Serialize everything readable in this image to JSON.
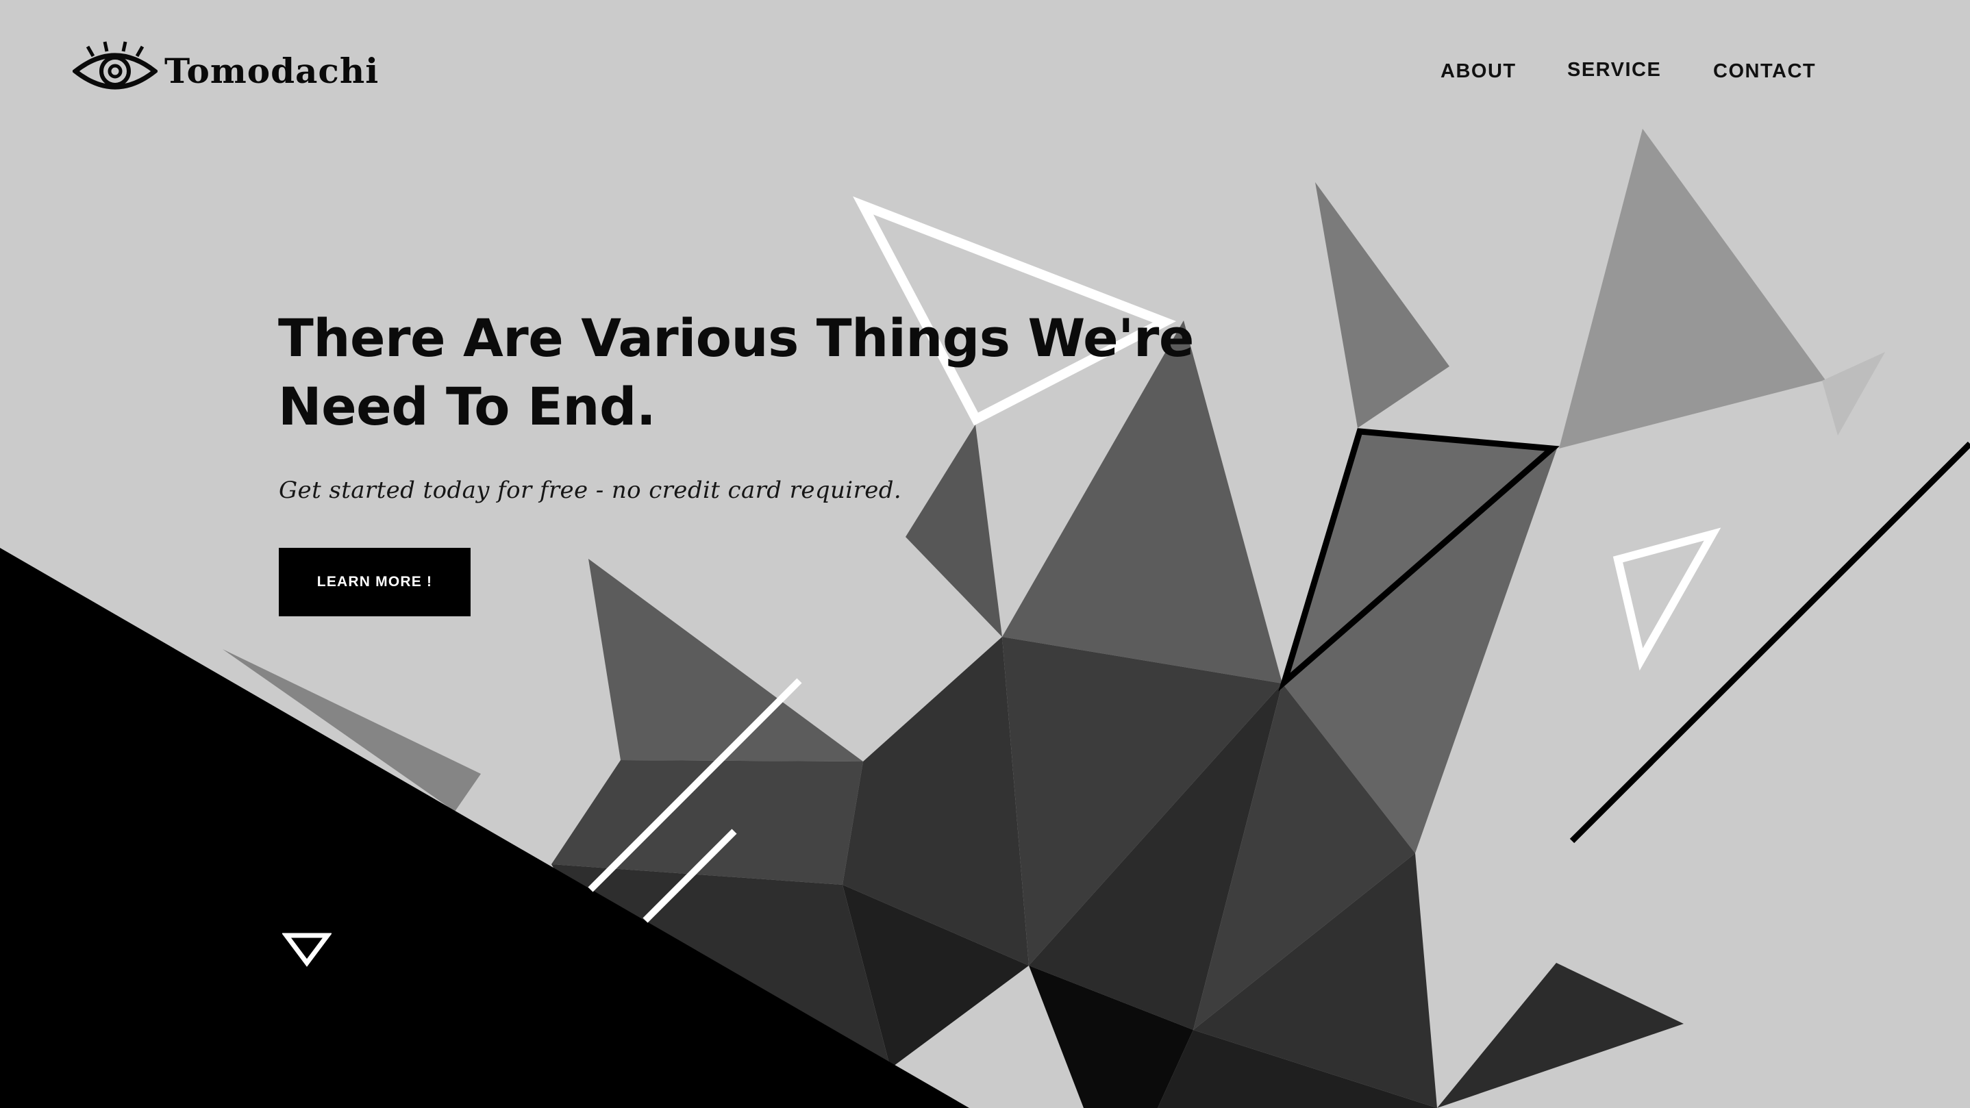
{
  "brand": {
    "name": "Tomodachi",
    "logo_icon": "eye-icon"
  },
  "nav": {
    "items": [
      {
        "label": "ABOUT"
      },
      {
        "label": "SERVICE"
      },
      {
        "label": "CONTACT"
      }
    ]
  },
  "hero": {
    "headline_line1": "There Are Various Things We're",
    "headline_line2": "Need To End.",
    "subtitle": "Get started today for free - no credit card required.",
    "cta_label": "LEARN MORE !"
  },
  "scroll_indicator": {
    "icon": "triangle-down-icon"
  },
  "colors": {
    "background": "#cbcbcb",
    "ink": "#000000",
    "cta_text": "#ffffff"
  }
}
